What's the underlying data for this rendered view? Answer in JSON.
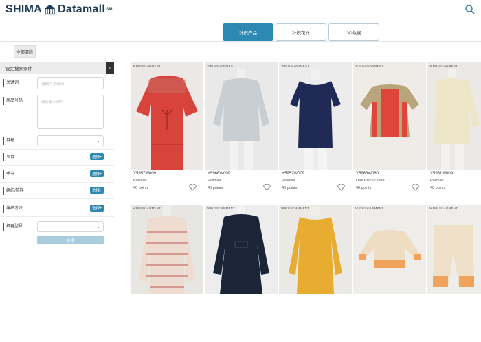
{
  "header": {
    "logo_left": "SHIMA",
    "logo_right": "Datamall",
    "logo_mark": "SM",
    "search_icon": "search-icon"
  },
  "tabs": [
    {
      "label": "针织产品",
      "active": true
    },
    {
      "label": "针织花样",
      "active": false
    },
    {
      "label": "3D数据",
      "active": false
    }
  ],
  "toolbar": {
    "clear_all": "全部清除"
  },
  "sidebar": {
    "title": "设定搜索条件",
    "keyword_label": "关键词",
    "keyword_placeholder": "请输入关键词",
    "product_no_label": "商品号码",
    "product_no_placeholder": "请行输入编号",
    "target_label": "目标",
    "item_label": "项目",
    "season_label": "季节",
    "structure_label": "组织/花样",
    "method_label": "编织方法",
    "machine_label": "机器型号",
    "select_label": "选择",
    "select_button": "选择"
  },
  "products": [
    {
      "brand": "WHOLEGARMENT",
      "code": "Y5957W009",
      "type": "Pullover",
      "points": "40 points"
    },
    {
      "brand": "WHOLEGARMENT",
      "code": "Y5966W009",
      "type": "Pullover",
      "points": "40 points"
    },
    {
      "brand": "WHOLEGARMENT",
      "code": "Y5952W009",
      "type": "Pullover",
      "points": "40 points"
    },
    {
      "brand": "WHOLEGARMENT",
      "code": "Y5963W080",
      "type": "One Piece Dress",
      "points": "40 points"
    },
    {
      "brand": "WHOLEGARMENT",
      "code": "Y5961W009",
      "type": "Pullover",
      "points": "40 points"
    },
    {
      "brand": "WHOLEGARMENT"
    },
    {
      "brand": "WHOLEGARMENT"
    },
    {
      "brand": "WHOLEGARMENT"
    },
    {
      "brand": "WHOLEGARMENT"
    },
    {
      "brand": "WHOLEGARMENT"
    }
  ],
  "colors": {
    "accent": "#2d88b3",
    "accent_light": "#a9cddd",
    "logo": "#1f3a58"
  }
}
